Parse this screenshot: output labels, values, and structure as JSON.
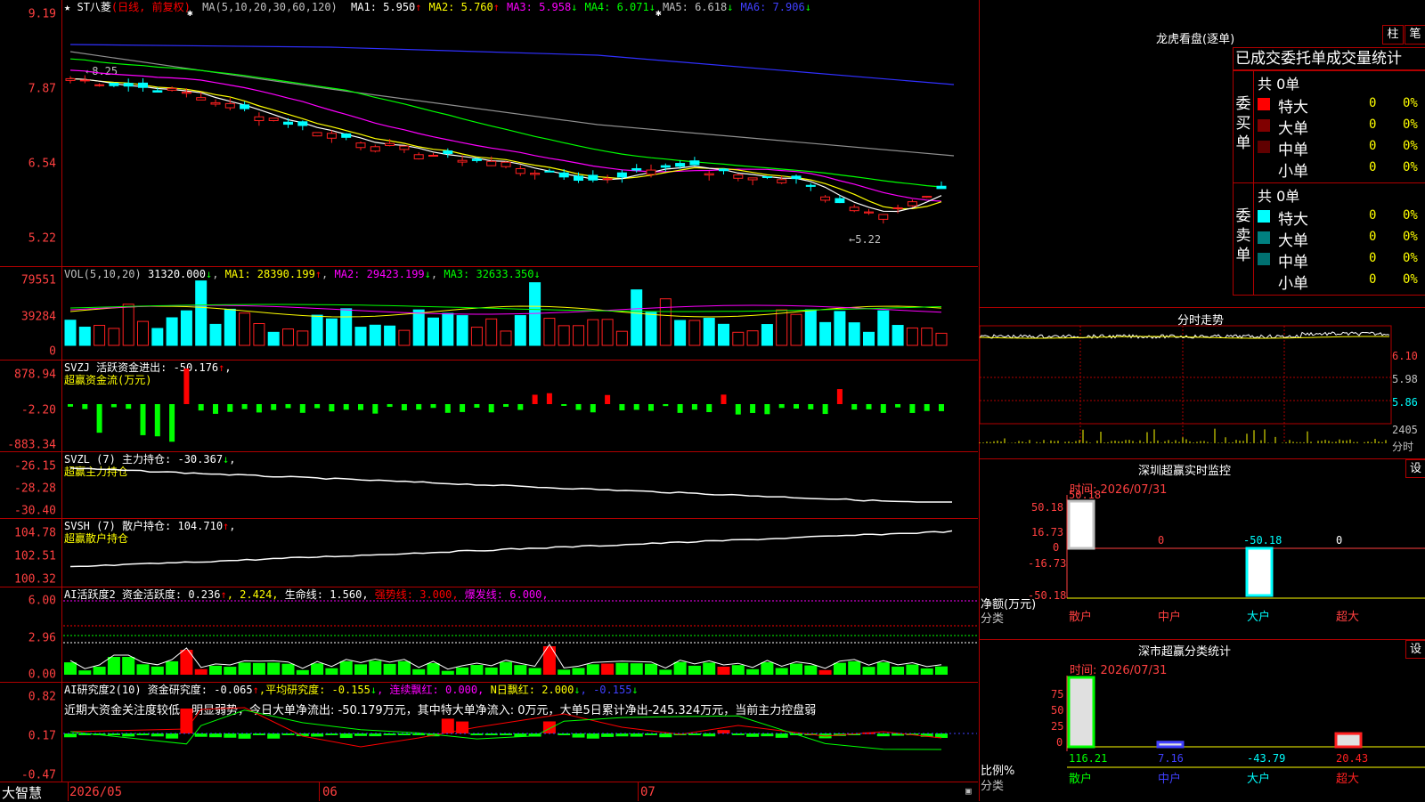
{
  "kline": {
    "star": "★",
    "title": "ST八菱",
    "period": "(日线, 前复权)",
    "ma_label": "MA(5,10,20,30,60,120)",
    "ma": [
      {
        "text": "MA1: 5.950",
        "arrow": "↑",
        "color": "#ffffff"
      },
      {
        "text": "MA2: 5.760",
        "arrow": "↑",
        "color": "#ffff00"
      },
      {
        "text": "MA3: 5.958",
        "arrow": "↓",
        "color": "#ff00ff"
      },
      {
        "text": "MA4: 6.071",
        "arrow": "↓",
        "color": "#00ff00"
      },
      {
        "text": "MA5: 6.618",
        "arrow": "↓",
        "color": "#c0c0c0"
      },
      {
        "text": "MA6: 7.906",
        "arrow": "↓",
        "color": "#4040ff"
      }
    ],
    "y_labels": [
      "9.19",
      "7.87",
      "6.54",
      "5.22"
    ],
    "high_label": "8.25",
    "low_label": "5.22"
  },
  "vol": {
    "title": "VOL(5,10,20)",
    "value": "31320.000",
    "arrow": "↓",
    "ma1": "MA1: 28390.199",
    "ma1_arrow": "↑",
    "ma2": "MA2: 29423.199",
    "ma2_arrow": "↓",
    "ma3": "MA3: 32633.350",
    "ma3_arrow": "↓",
    "y_labels": [
      "79551",
      "39284",
      "0"
    ]
  },
  "svzj": {
    "line1": "SVZJ  活跃资金进出: -50.176",
    "arrow": "↑",
    "comma": ",",
    "line2": "超赢资金流(万元)",
    "y_labels": [
      "878.94",
      "-2.20",
      "-883.34"
    ]
  },
  "svzl": {
    "line1": "SVZL (7) 主力持仓: -30.367",
    "arrow": "↓",
    "comma": ",",
    "line2": "超赢主力持仓",
    "y_labels": [
      "-26.15",
      "-28.28",
      "-30.40"
    ]
  },
  "svsh": {
    "line1": "SVSH (7) 散户持仓: 104.710",
    "arrow": "↑",
    "comma": ",",
    "line2": "超赢散户持仓",
    "y_labels": [
      "104.78",
      "102.51",
      "100.32"
    ]
  },
  "ai1": {
    "title": "AI活跃度2 资金活跃度: 0.236",
    "arrow": "↑",
    "v2": ", 2.424,",
    "v3": " 生命线: 1.560,",
    "v4": " 强势线: 3.000,",
    "v5": " 爆发线: 6.000,",
    "y_labels": [
      "6.00",
      "2.96",
      "0.00"
    ]
  },
  "ai2": {
    "title": "AI研究度2(10) 资金研究度: -0.065",
    "arrow1": "↑",
    "v2": ",平均研究度: -0.155",
    "arrow2": "↓",
    "v3": ", 连续飘红: 0.000,",
    "v4": " N日飘红: 2.000",
    "arrow4": "↓",
    "v5": ", -0.155",
    "arrow5": "↓",
    "note": "近期大资金关注度较低，明显弱势，今日大单净流出: -50.179万元，其中特大单净流入: 0万元，大单5日累计净出-245.324万元，当前主力控盘弱",
    "y_labels": [
      "0.82",
      "0.17",
      "-0.47"
    ]
  },
  "bottom": {
    "brand": "大智慧",
    "dates": [
      "2026/05",
      "06",
      "07"
    ]
  },
  "dragon": {
    "title": "龙虎看盘(逐单)",
    "btn1": "柱",
    "btn2": "笔",
    "stat_title": "已成交委托单成交量统计",
    "buy_label": "委买单",
    "sell_label": "委卖单",
    "buy_total": "共 0单",
    "sell_total": "共 0单",
    "buy_rows": [
      {
        "label": "特大",
        "count": "0",
        "pct": "0%",
        "color": "#ff0000"
      },
      {
        "label": "大单",
        "count": "0",
        "pct": "0%",
        "color": "#800000"
      },
      {
        "label": "中单",
        "count": "0",
        "pct": "0%",
        "color": "#600000"
      },
      {
        "label": "小单",
        "count": "0",
        "pct": "0%",
        "color": ""
      }
    ],
    "sell_rows": [
      {
        "label": "特大",
        "count": "0",
        "pct": "0%",
        "color": "#00ffff"
      },
      {
        "label": "大单",
        "count": "0",
        "pct": "0%",
        "color": "#008080"
      },
      {
        "label": "中单",
        "count": "0",
        "pct": "0%",
        "color": "#007070"
      },
      {
        "label": "小单",
        "count": "0",
        "pct": "0%",
        "color": ""
      }
    ]
  },
  "minute": {
    "title": "分时走势",
    "y_labels": [
      "6.10",
      "5.98",
      "5.86"
    ],
    "vol_label": "2405",
    "vol_unit": "分时"
  },
  "monitor": {
    "title": "深圳超赢实时监控",
    "set": "设",
    "time": "时间: 2026/07/31",
    "y_labels": [
      "50.18",
      "16.73",
      "0",
      "-16.73",
      "-50.18"
    ],
    "axis_label": "净额(万元)",
    "axis_label2": "分类",
    "bar_values": [
      "50.18",
      "0",
      "-50.18",
      "0"
    ],
    "categories": [
      "散户",
      "中户",
      "大户",
      "超大"
    ]
  },
  "classify": {
    "title": "深市超赢分类统计",
    "set": "设",
    "time": "时间: 2026/07/31",
    "y_labels": [
      "75",
      "50",
      "25",
      "0"
    ],
    "axis_label": "比例%",
    "axis_label2": "分类",
    "values": [
      "116.21",
      "7.16",
      "-43.79",
      "20.43"
    ],
    "categories": [
      "散户",
      "中户",
      "大户",
      "超大"
    ]
  }
}
